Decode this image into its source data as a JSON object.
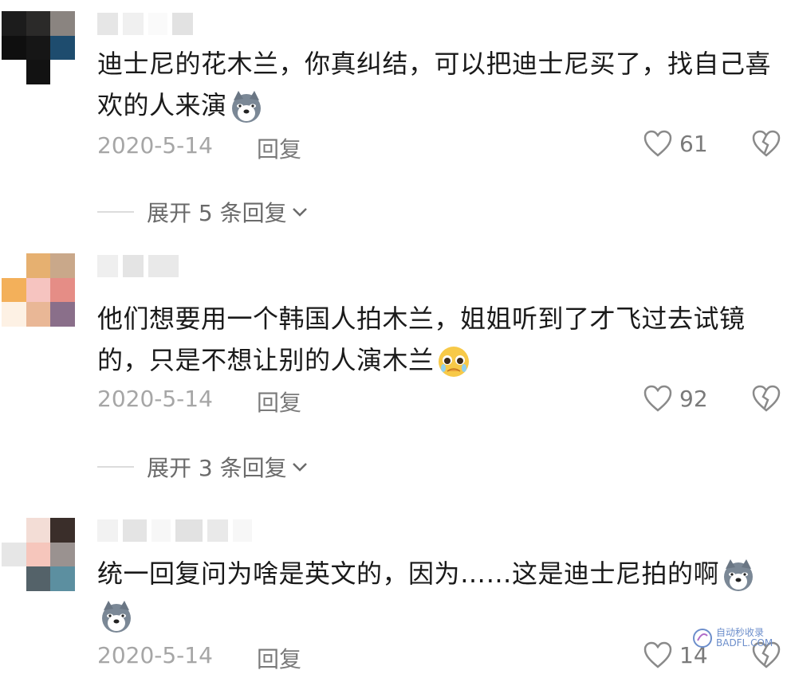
{
  "comments": [
    {
      "text": "迪士尼的花木兰，你真纠结，可以把迪士尼买了，找自己喜欢的人来演",
      "date": "2020-5-14",
      "reply_label": "回复",
      "likes": "61",
      "expand": "展开 5 条回复",
      "emoji": "dog-face"
    },
    {
      "text": "他们想要用一个韩国人拍木兰，姐姐听到了才飞过去试镜的，只是不想让别的人演木兰",
      "date": "2020-5-14",
      "reply_label": "回复",
      "likes": "92",
      "expand": "展开 3 条回复",
      "emoji": "pleading-face"
    },
    {
      "text": "统一回复问为啥是英文的，因为……这是迪士尼拍的啊",
      "date": "2020-5-14",
      "reply_label": "回复",
      "likes": "14",
      "emoji": "dog-face"
    }
  ],
  "icons": {
    "like": "heart-outline-icon",
    "dislike": "broken-heart-icon",
    "expand": "chevron-down-icon"
  },
  "watermark": {
    "line1": "自动秒收录",
    "line2": "BADFL.COM"
  },
  "colors": {
    "meta": "#a6a6a6",
    "text": "#1a1a1a",
    "accent": "#6c8ecb"
  }
}
